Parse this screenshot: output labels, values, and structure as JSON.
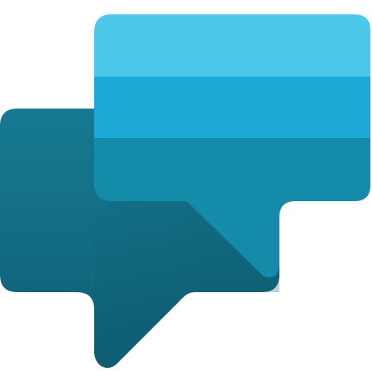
{
  "icon": {
    "name": "chat-bubbles-icon",
    "colors": {
      "back_bubble_top": "#167A92",
      "back_bubble_bottom": "#0E5F74",
      "back_bubble_shadow": "#0A4C5D",
      "front_band_top": "#4CC8EA",
      "front_band_middle": "#1CA9D5",
      "front_band_bottom": "#158BAA",
      "front_tail": "#137E9B"
    }
  }
}
